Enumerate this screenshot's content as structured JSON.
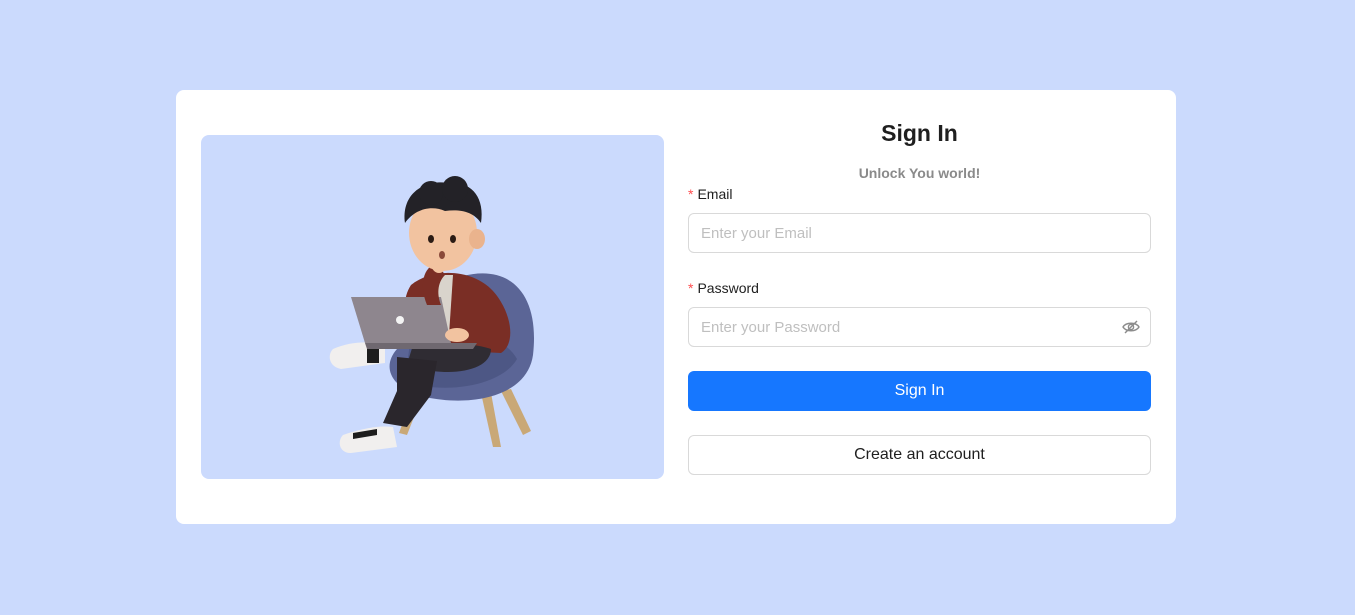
{
  "colors": {
    "page_background": "#cbdafd",
    "card_background": "#ffffff",
    "primary": "#1677ff",
    "required_mark": "#ff4d4f"
  },
  "signin": {
    "title": "Sign In",
    "subtitle": "Unlock You world!",
    "email": {
      "required_mark": "*",
      "label": "Email",
      "placeholder": "Enter your Email"
    },
    "password": {
      "required_mark": "*",
      "label": "Password",
      "placeholder": "Enter your Password",
      "toggle_icon": "eye-invisible-icon"
    },
    "submit_label": "Sign In",
    "create_account_label": "Create an account"
  },
  "illustration": {
    "icon": "person-with-laptop-illustration"
  }
}
